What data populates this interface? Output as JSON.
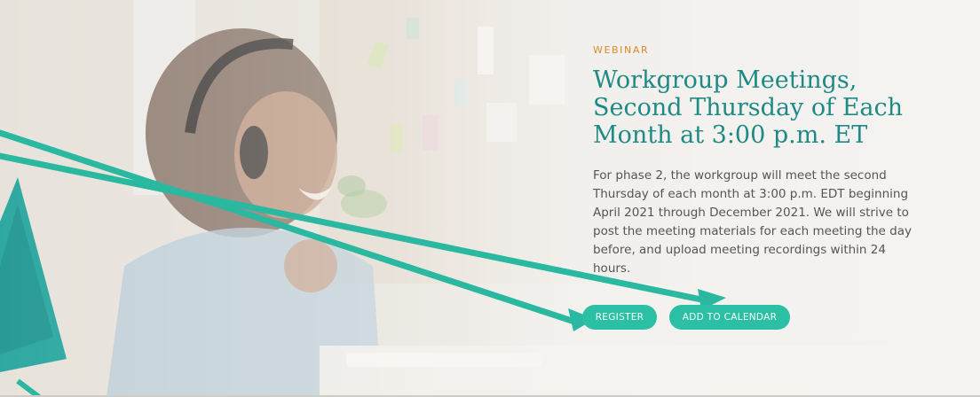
{
  "event": {
    "category": "WEBINAR",
    "title": "Workgroup Meetings, Second Thursday of Each Month at 3:00 p.m. ET",
    "description": "For phase 2, the workgroup will meet the second Thursday of each month at 3:00 p.m. EDT beginning April 2021 through December 2021. We will strive to post the meeting materials for each meeting the day before, and upload meeting recordings within 24 hours."
  },
  "actions": {
    "register_label": "REGISTER",
    "calendar_label": "ADD TO CALENDAR"
  },
  "colors": {
    "accent": "#2bbfa5",
    "title": "#1f8a85",
    "eyebrow": "#d98a2b",
    "annotation_arrow": "#2ab8a0"
  },
  "background": {
    "image": "woman-with-headphones-on-video-call-photo"
  }
}
